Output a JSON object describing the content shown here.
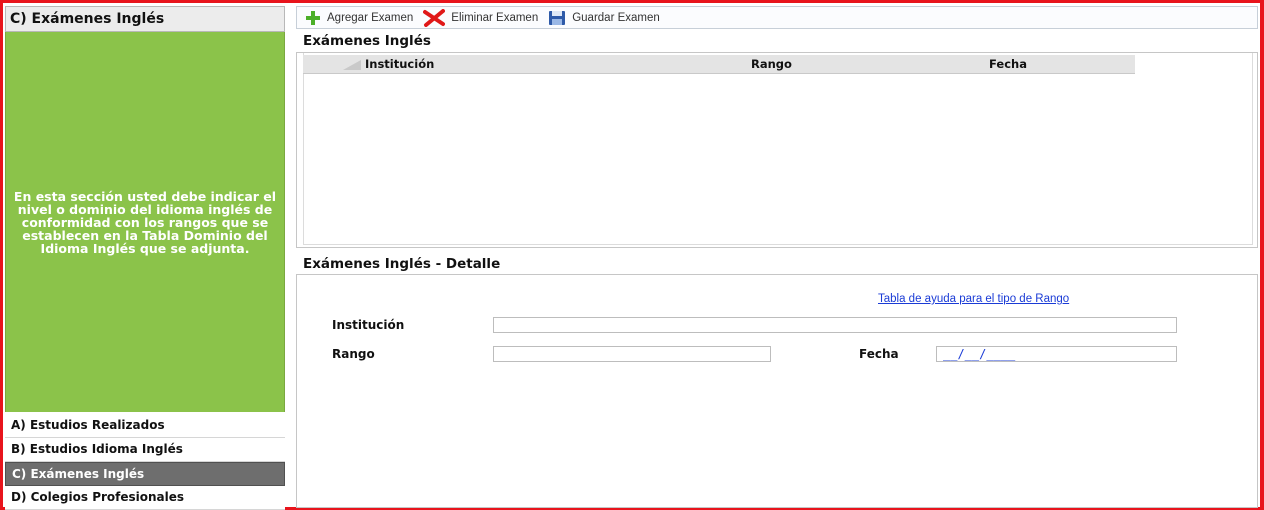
{
  "sidebar": {
    "title": "C) Exámenes Inglés",
    "info_text": "En esta sección usted debe indicar el nivel o dominio del idioma inglés de conformidad con los rangos que se establecen en la Tabla Dominio del Idioma Inglés que se adjunta.",
    "nav": [
      {
        "label": "A) Estudios Realizados",
        "active": false
      },
      {
        "label": "B) Estudios Idioma Inglés",
        "active": false
      },
      {
        "label": "C) Exámenes Inglés",
        "active": true
      },
      {
        "label": "D) Colegios Profesionales",
        "active": false
      }
    ]
  },
  "toolbar": {
    "add_label": "Agregar Examen",
    "delete_label": "Eliminar Examen",
    "save_label": "Guardar Examen",
    "add_icon": "plus-icon",
    "delete_icon": "x-icon",
    "save_icon": "floppy-disk-icon"
  },
  "grid": {
    "title": "Exámenes Inglés",
    "columns": [
      "Institución",
      "Rango",
      "Fecha"
    ],
    "rows": []
  },
  "detail": {
    "title": "Exámenes Inglés - Detalle",
    "help_link": "Tabla de ayuda para el tipo de Rango",
    "institucion_label": "Institución",
    "institucion_value": "",
    "rango_label": "Rango",
    "rango_value": "",
    "fecha_label": "Fecha",
    "fecha_value": "__/__/____"
  },
  "colors": {
    "accent_border": "#e8141c",
    "info_panel": "#8bc34a",
    "active_nav": "#6e6e6e",
    "link": "#1a3bd6"
  }
}
